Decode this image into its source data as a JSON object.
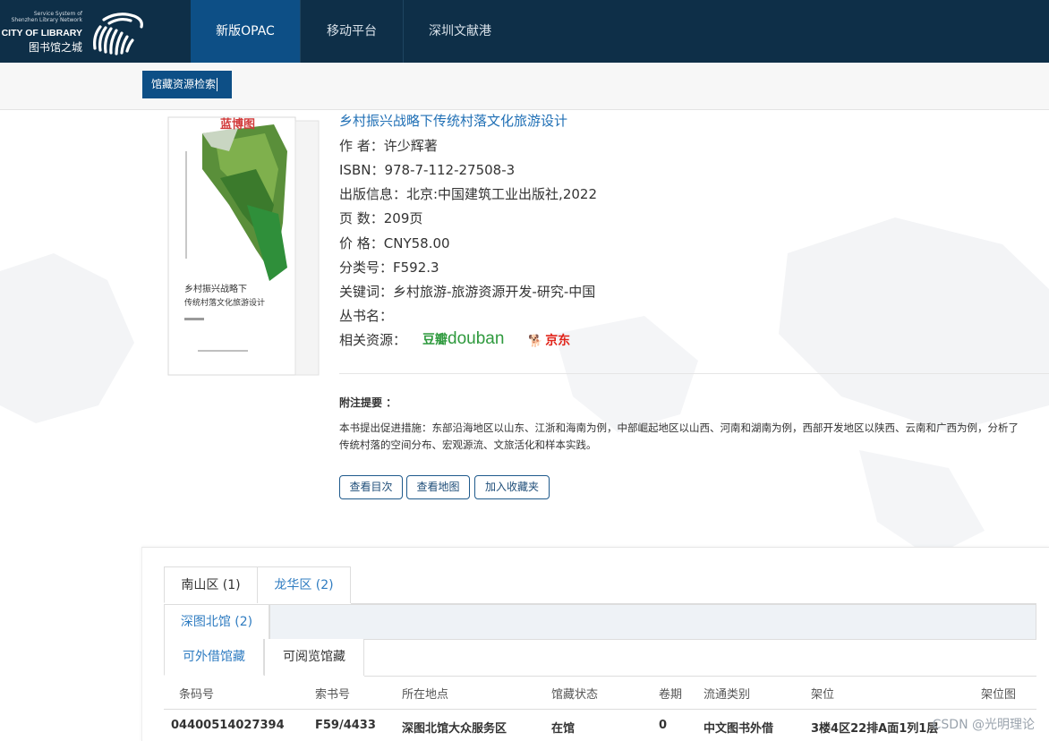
{
  "header": {
    "logo": {
      "tagline_line1": "Service System of",
      "tagline_line2": "Shenzhen Library Network",
      "name_en": "CITY OF LIBRARY",
      "name_cn": "图书馆之城"
    },
    "nav": [
      {
        "label": "新版OPAC",
        "active": true
      },
      {
        "label": "移动平台",
        "active": false
      },
      {
        "label": "深圳文献港",
        "active": false
      }
    ],
    "search_tab": "馆藏资源检索"
  },
  "book": {
    "title": "乡村振兴战略下传统村落文化旅游设计",
    "cover_publisher_mark": "蓝博图",
    "cover_title_line1": "乡村振兴战略下",
    "cover_title_line2": "传统村落文化旅游设计",
    "author": "作 者：许少辉著",
    "isbn": "ISBN：978-7-112-27508-3",
    "publication": "出版信息：北京:中国建筑工业出版社,2022",
    "pages": "页 数：209页",
    "price": "价 格：CNY58.00",
    "classification": "分类号：F592.3",
    "keywords": "关键词：乡村旅游-旅游资源开发-研究-中国",
    "series": "丛书名：",
    "related_resources": "相关资源：",
    "douban_cn": "豆瓣",
    "douban_en": "douban",
    "jd_label": "京东",
    "notes_label": "附注提要 ：",
    "notes_line1": "本书提出促进措施：东部沿海地区以山东、江浙和海南为例，中部崛起地区以山西、河南和湖南为例，西部开发地区以陕西、云南和广西为例，分析了",
    "notes_line2": "传统村落的空间分布、宏观源流、文旅活化和样本实践。",
    "buttons": [
      "查看目次",
      "查看地图",
      "加入收藏夹"
    ]
  },
  "holdings": {
    "district_tabs": [
      {
        "label": "南山区 (1)",
        "active": true
      },
      {
        "label": "龙华区 (2)",
        "active": false
      }
    ],
    "library_tab": "深图北馆 (2)",
    "holding_tabs": [
      {
        "label": "可外借馆藏",
        "active": true
      },
      {
        "label": "可阅览馆藏",
        "active": false
      }
    ],
    "columns": [
      "条码号",
      "索书号",
      "所在地点",
      "馆藏状态",
      "卷期",
      "流通类别",
      "架位",
      "架位图"
    ],
    "rows": [
      [
        "04400514027394",
        "F59/4433",
        "深图北馆大众服务区",
        "在馆",
        "0",
        "中文图书外借",
        "3楼4区22排A面1列1层",
        ""
      ]
    ]
  },
  "watermark": "CSDN @光明理论"
}
